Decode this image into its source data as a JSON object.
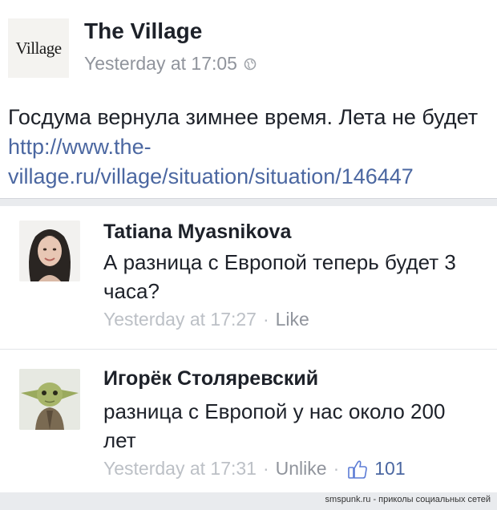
{
  "post": {
    "logo_text": "Village",
    "page_name": "The Village",
    "timestamp": "Yesterday at 17:05",
    "audience_icon": "globe-icon",
    "text": "Госдума вернула зимнее время. Лета не будет ",
    "link": "http://www.the-village.ru/village/situation/situation/146447"
  },
  "comments": [
    {
      "author": "Tatiana Myasnikova",
      "text": "А разница с Европой теперь будет 3 часа?",
      "timestamp": "Yesterday at 17:27",
      "separator": "·",
      "action": "Like"
    },
    {
      "author": "Игорёк Столяревский",
      "text": "разница с Европой у нас около 200 лет",
      "timestamp": "Yesterday at 17:31",
      "separator": "·",
      "action": "Unlike",
      "separator2": "·",
      "like_icon": "thumbs-up-icon",
      "like_count": "101"
    }
  ],
  "watermark": "smspunk.ru - приколы социальных сетей",
  "colors": {
    "link": "#4b67a1",
    "meta": "#90949c",
    "background": "#e9ebee"
  }
}
